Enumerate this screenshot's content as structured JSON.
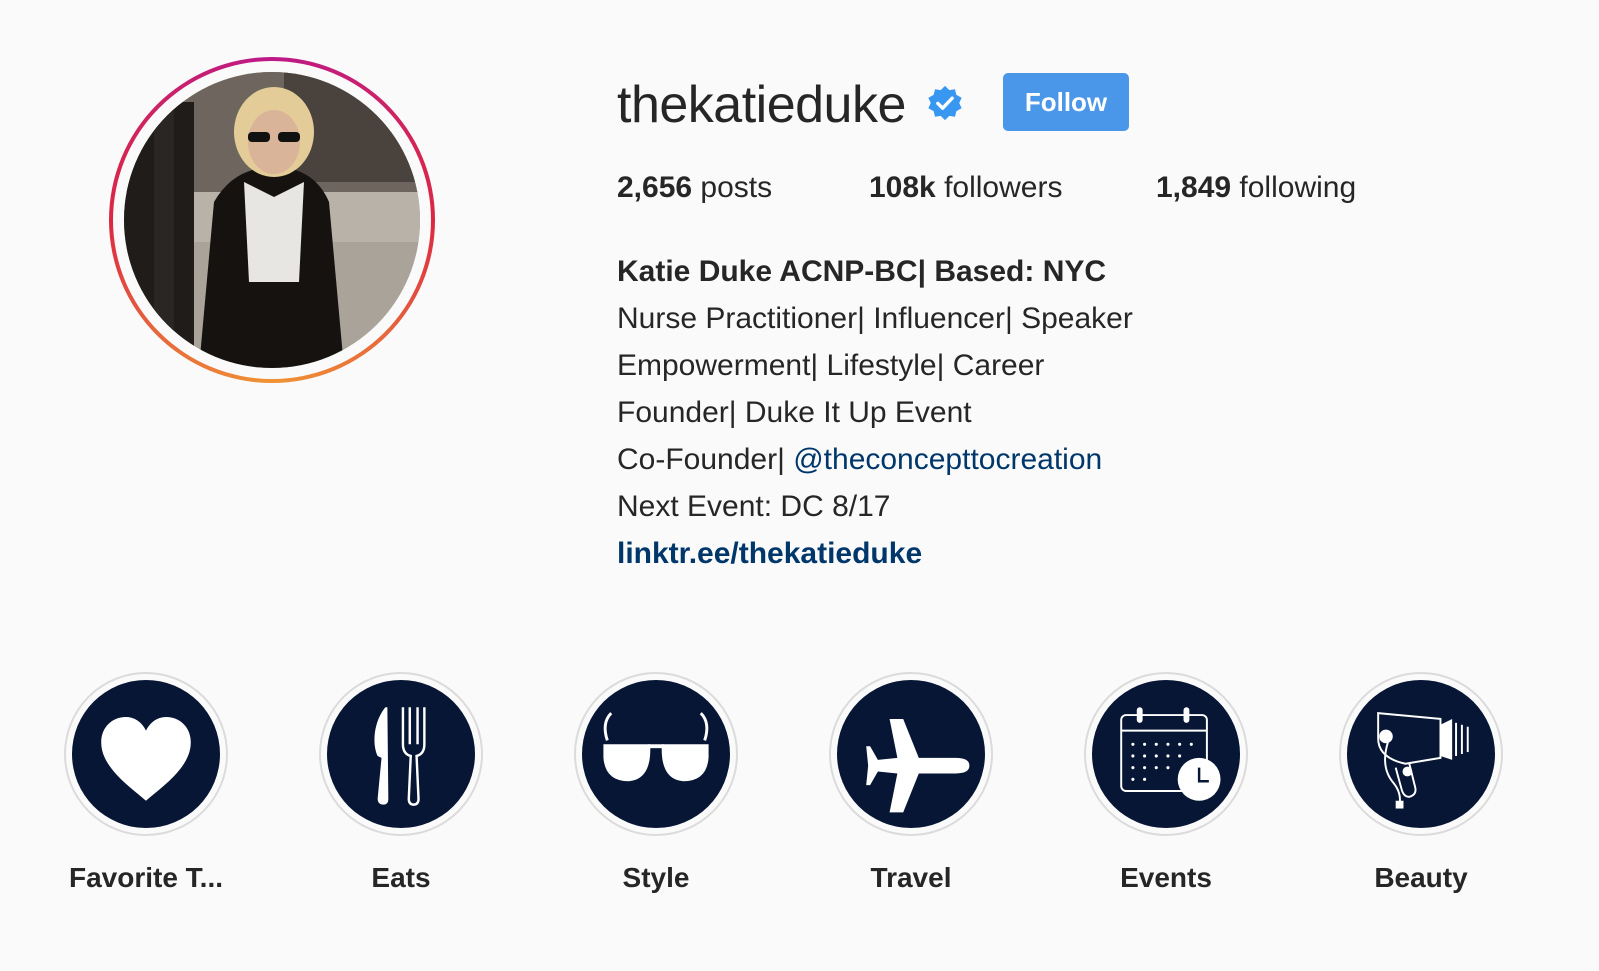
{
  "profile": {
    "username": "thekatieduke",
    "verified": true,
    "follow_label": "Follow",
    "accent_color": "#4a96e8"
  },
  "stats": {
    "posts_count": "2,656",
    "posts_label": " posts",
    "followers_count": "108k",
    "followers_label": " followers",
    "following_count": "1,849",
    "following_label": " following"
  },
  "bio": {
    "name": "Katie Duke ACNP-BC| Based: NYC",
    "line1": "Nurse Practitioner| Influencer| Speaker",
    "line2": "Empowerment| Lifestyle| Career",
    "line3": "Founder| Duke It Up Event",
    "line4_prefix": "Co-Founder| ",
    "line4_mention": "@theconcepttocreation",
    "line5": "Next Event: DC 8/17",
    "link": "linktr.ee/thekatieduke"
  },
  "highlights": [
    {
      "label": "Favorite T...",
      "icon": "heart-icon"
    },
    {
      "label": "Eats",
      "icon": "knife-fork-icon"
    },
    {
      "label": "Style",
      "icon": "glasses-icon"
    },
    {
      "label": "Travel",
      "icon": "airplane-icon"
    },
    {
      "label": "Events",
      "icon": "calendar-clock-icon"
    },
    {
      "label": "Beauty",
      "icon": "hair-dryer-icon"
    }
  ]
}
